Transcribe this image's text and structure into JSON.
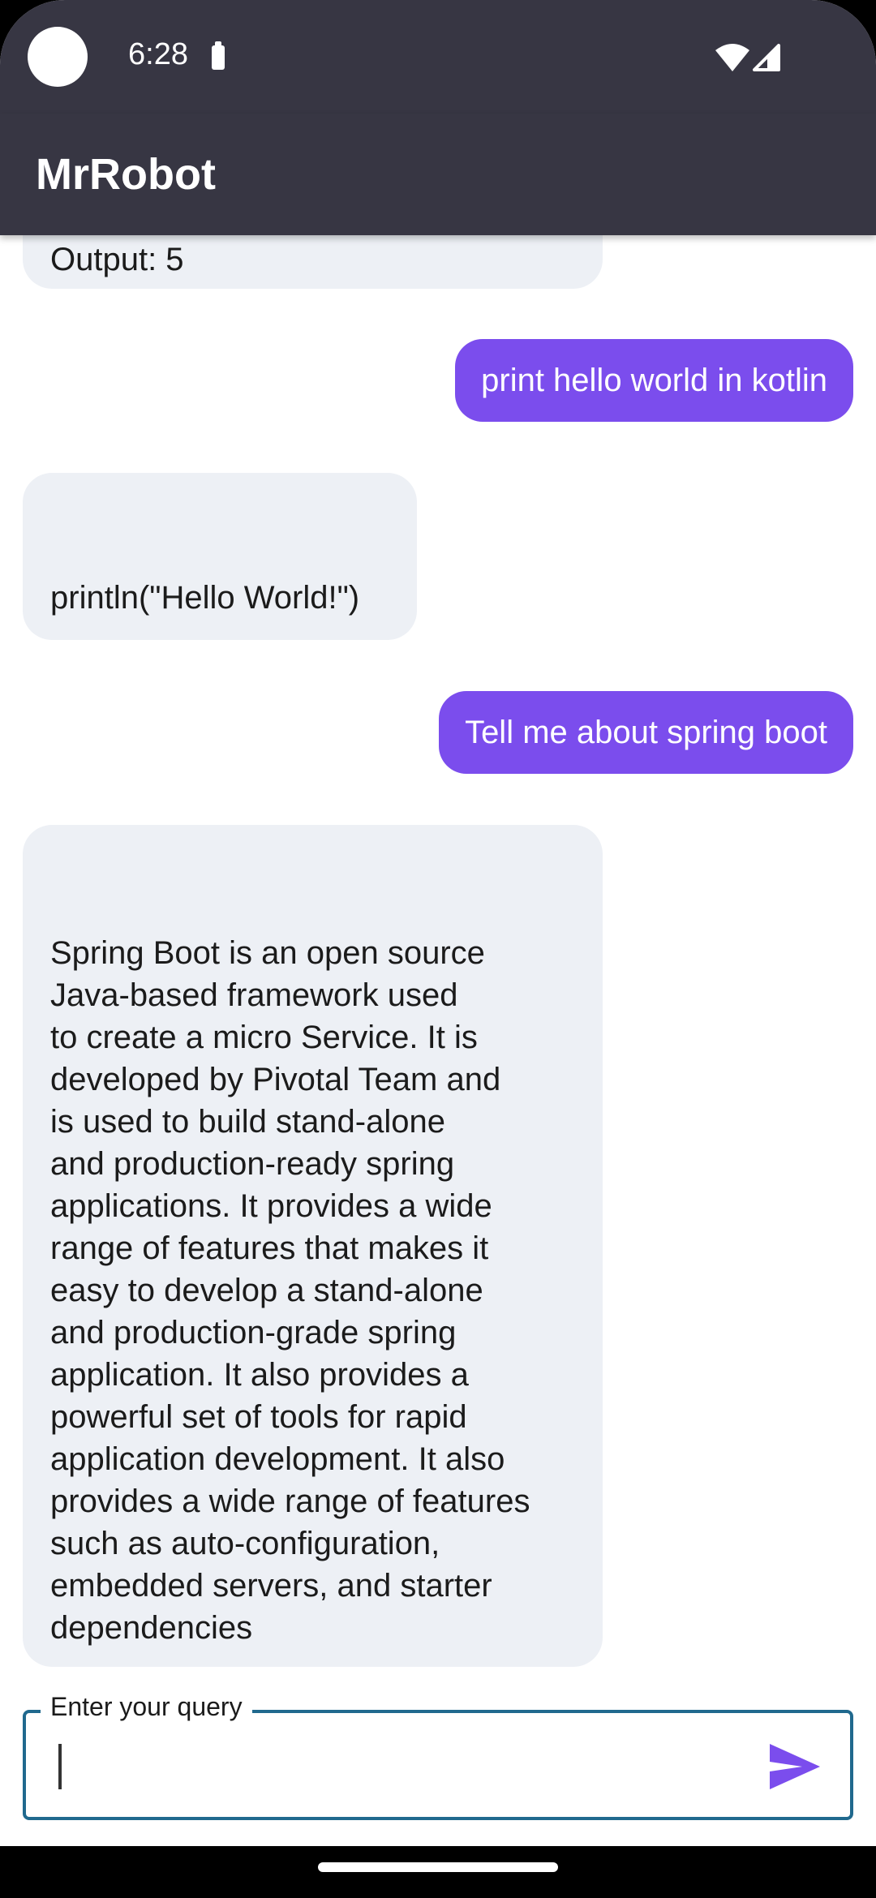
{
  "status_bar": {
    "time": "6:28"
  },
  "app_bar": {
    "title": "MrRobot"
  },
  "messages": [
    {
      "sender": "bot",
      "text": "Output: 5"
    },
    {
      "sender": "user",
      "text": "print hello world in kotlin"
    },
    {
      "sender": "bot",
      "text": "println(\"Hello World!\")"
    },
    {
      "sender": "user",
      "text": "Tell me about spring boot"
    },
    {
      "sender": "bot",
      "text": "Spring Boot is an open source\nJava-based framework used\nto create a micro Service. It is\ndeveloped by Pivotal Team and\nis used to build stand-alone\nand production-ready spring\napplications. It provides a wide\nrange of features that makes it\neasy to develop a stand-alone\nand production-grade spring\napplication. It also provides a\npowerful set of tools for rapid\napplication development. It also\nprovides a wide range of features\nsuch as auto-configuration,\nembedded servers, and starter\ndependencies"
    }
  ],
  "input": {
    "label": "Enter your query",
    "value": ""
  },
  "icons": {
    "send": "send-icon",
    "wifi": "wifi-icon",
    "signal": "signal-icon",
    "battery": "battery-icon"
  },
  "colors": {
    "app_bar": "#373643",
    "user_bubble": "#7b4ded",
    "bot_bubble": "#edf0f5",
    "input_border": "#20698e",
    "send_icon": "#7b4ded"
  }
}
